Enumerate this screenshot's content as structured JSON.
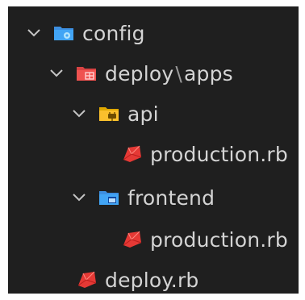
{
  "tree": {
    "config": {
      "label": "config",
      "icon": "folder-config-icon",
      "color": "#42a5f5"
    },
    "deploy": {
      "folder": "deploy",
      "separator": "\\",
      "subfolder": "apps",
      "icon": "folder-deploy-icon",
      "color": "#ef5350"
    },
    "api": {
      "label": "api",
      "icon": "folder-api-icon",
      "color": "#fbc02d"
    },
    "api_file": {
      "label": "production.rb",
      "icon": "ruby-file-icon"
    },
    "frontend": {
      "label": "frontend",
      "icon": "folder-frontend-icon",
      "color": "#42a5f5"
    },
    "frontend_file": {
      "label": "production.rb",
      "icon": "ruby-file-icon"
    },
    "deploy_file": {
      "label": "deploy.rb",
      "icon": "ruby-file-icon"
    }
  },
  "colors": {
    "background": "#1f1f1f",
    "text": "#d4d4d4",
    "ruby": "#e53935"
  }
}
